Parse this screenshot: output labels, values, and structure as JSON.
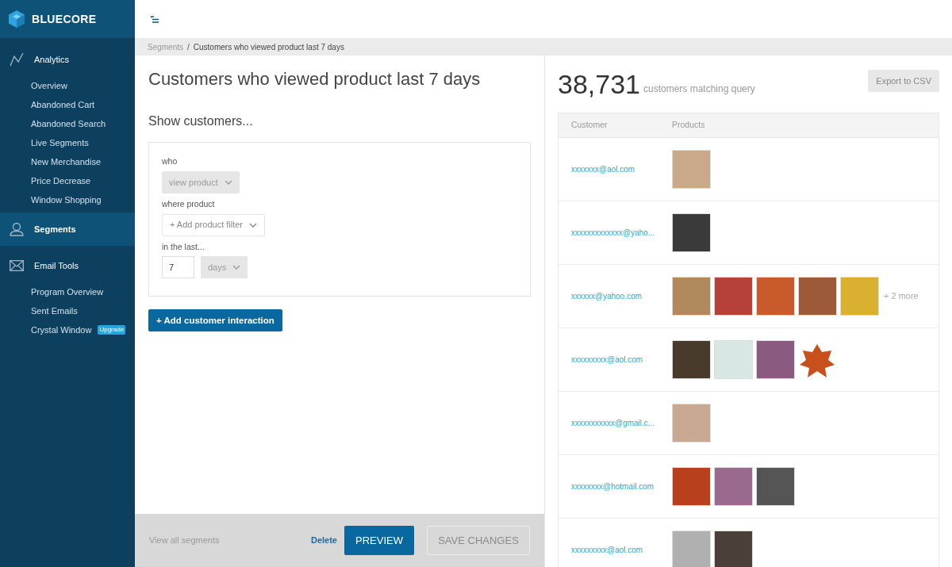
{
  "brand": {
    "name": "BLUECORE"
  },
  "sidebar": {
    "sections": [
      {
        "title": "Analytics",
        "selected": false,
        "items": [
          {
            "label": "Overview"
          },
          {
            "label": "Abandoned Cart"
          },
          {
            "label": "Abandoned Search"
          },
          {
            "label": "Live Segments"
          },
          {
            "label": "New Merchandise"
          },
          {
            "label": "Price Decrease"
          },
          {
            "label": "Window Shopping"
          }
        ]
      },
      {
        "title": "Segments",
        "selected": true
      },
      {
        "title": "Email Tools",
        "selected": false,
        "items": [
          {
            "label": "Program Overview"
          },
          {
            "label": "Sent Emails"
          },
          {
            "label": "Crystal Window",
            "badge": "Upgrade"
          }
        ]
      }
    ]
  },
  "breadcrumb": [
    "Segments",
    "Customers who viewed product last 7 days"
  ],
  "breadcrumb_separator": "/",
  "segment": {
    "title": "Customers who viewed product last 7 days",
    "subtitle": "Show customers...",
    "fields": [
      {
        "label": "who",
        "kind": "select",
        "value": "view product",
        "disabled": true
      },
      {
        "label": "where product",
        "kind": "select",
        "value": "+ Add product filter",
        "disabled": false
      },
      {
        "label": "in the last...",
        "kind": "number_unit",
        "value": "7",
        "unit": "days",
        "disabled": true
      }
    ],
    "add_button": "+ Add customer interaction"
  },
  "footer": {
    "link": "View all segments",
    "delete": "Delete",
    "preview": "PREVIEW",
    "save": {
      "label": "SAVE CHANGES",
      "disabled": true
    }
  },
  "results": {
    "count": "38,731",
    "count_label": "customers matching query",
    "export": "Export to CSV",
    "columns": [
      "Customer",
      "Products"
    ],
    "rows": [
      {
        "customer": "xxxxxxx@aol.com",
        "products": [
          {
            "kind": "photo",
            "color": "#c9a98a"
          }
        ]
      },
      {
        "customer": "xxxxxxxxxxxxx@yaho...",
        "products": [
          {
            "kind": "photo",
            "color": "#3a3a3a"
          }
        ]
      },
      {
        "customer": "xxxxxx@yahoo.com",
        "products": [
          {
            "kind": "photo",
            "color": "#b08a5c"
          },
          {
            "kind": "photo",
            "color": "#b5413a"
          },
          {
            "kind": "photo",
            "color": "#c85a2c"
          },
          {
            "kind": "photo",
            "color": "#9c5a38"
          },
          {
            "kind": "photo",
            "color": "#d9b030"
          }
        ],
        "more": "+ 2 more"
      },
      {
        "customer": "xxxxxxxxx@aol.com",
        "products": [
          {
            "kind": "photo",
            "color": "#4a3a2c"
          },
          {
            "kind": "photo",
            "color": "#d8e6e4"
          },
          {
            "kind": "photo",
            "color": "#8a5a80"
          },
          {
            "kind": "cutout",
            "color": "#c8501c"
          }
        ]
      },
      {
        "customer": "xxxxxxxxxxx@gmail.c...",
        "products": [
          {
            "kind": "photo",
            "color": "#c8a890"
          }
        ]
      },
      {
        "customer": "xxxxxxxx@hotmail.com",
        "products": [
          {
            "kind": "photo",
            "color": "#b8401c"
          },
          {
            "kind": "photo",
            "color": "#9a6a8e"
          },
          {
            "kind": "photo",
            "color": "#555555"
          }
        ]
      },
      {
        "customer": "xxxxxxxxx@aol.com",
        "products": [
          {
            "kind": "photo",
            "color": "#b0b0b0"
          },
          {
            "kind": "photo",
            "color": "#4a4038"
          }
        ]
      }
    ]
  }
}
